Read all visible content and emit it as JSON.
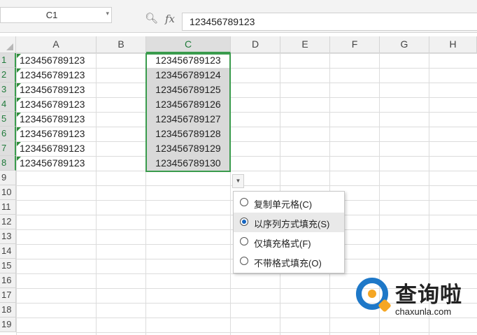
{
  "formula_bar": {
    "name_box": "C1",
    "zoom_icon": "zoom-icon",
    "fx_label": "fx",
    "formula_value": "123456789123"
  },
  "columns": [
    "A",
    "B",
    "C",
    "D",
    "E",
    "F",
    "G",
    "H"
  ],
  "rows": [
    "1",
    "2",
    "3",
    "4",
    "5",
    "6",
    "7",
    "8",
    "9",
    "10",
    "11",
    "12",
    "13",
    "14",
    "15",
    "16",
    "17",
    "18",
    "19"
  ],
  "column_a_values": [
    "123456789123",
    "123456789123",
    "123456789123",
    "123456789123",
    "123456789123",
    "123456789123",
    "123456789123",
    "123456789123"
  ],
  "column_c_values": [
    "123456789123",
    "123456789124",
    "123456789125",
    "123456789126",
    "123456789127",
    "123456789128",
    "123456789129",
    "123456789130"
  ],
  "autofill_menu": {
    "options": [
      {
        "label": "复制单元格(C)",
        "selected": false
      },
      {
        "label": "以序列方式填充(S)",
        "selected": true
      },
      {
        "label": "仅填充格式(F)",
        "selected": false
      },
      {
        "label": "不带格式填充(O)",
        "selected": false
      }
    ]
  },
  "watermark": {
    "title": "查询啦",
    "url": "chaxunla.com"
  },
  "colors": {
    "selection_border": "#3a9b4d",
    "header_bg": "#f1f1f1",
    "radio_fill": "#1565c0",
    "watermark_blue": "#1e78c8",
    "watermark_orange": "#f5a623"
  }
}
